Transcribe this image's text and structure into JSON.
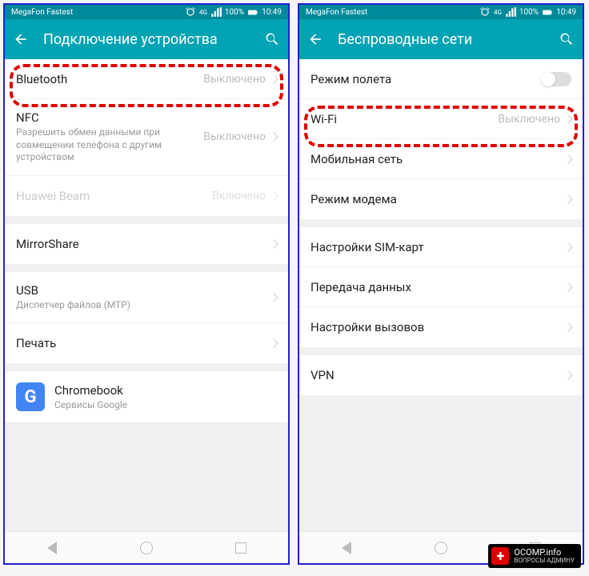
{
  "statusbar": {
    "carrier": "MegaFon Fastest",
    "battery": "100%",
    "time": "10:49"
  },
  "left_screen": {
    "title": "Подключение устройства",
    "groups": [
      [
        {
          "title": "Bluetooth",
          "value": "Выключено",
          "highlight": true
        },
        {
          "title": "NFC",
          "sub": "Разрешить обмен данными при совмещении телефона с другим устройством",
          "value": "Выключено"
        },
        {
          "title": "Huawei Beam",
          "value": "Включено",
          "disabled": true
        }
      ],
      [
        {
          "title": "MirrorShare"
        }
      ],
      [
        {
          "title": "USB",
          "sub": "Диспетчер файлов (MTP)"
        },
        {
          "title": "Печать"
        }
      ],
      [
        {
          "title": "Chromebook",
          "sub": "Сервисы Google",
          "appicon": "G"
        }
      ]
    ]
  },
  "right_screen": {
    "title": "Беспроводные сети",
    "groups": [
      [
        {
          "title": "Режим полета",
          "toggle": true
        },
        {
          "title": "Wi-Fi",
          "value": "Выключено",
          "highlight": true
        },
        {
          "title": "Мобильная сеть"
        },
        {
          "title": "Режим модема"
        }
      ],
      [
        {
          "title": "Настройки SIM-карт"
        },
        {
          "title": "Передача данных"
        },
        {
          "title": "Настройки вызовов"
        }
      ],
      [
        {
          "title": "VPN"
        }
      ]
    ]
  },
  "watermark": {
    "main": "OCOMP.info",
    "sub": "ВОПРОСЫ АДМИНУ"
  }
}
